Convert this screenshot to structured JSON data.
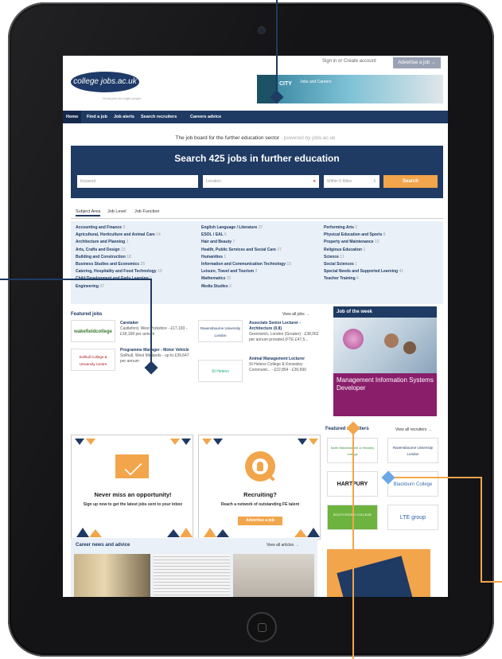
{
  "header": {
    "signin": "Sign in",
    "separator": "or",
    "create_account": "Create account",
    "advertise": "Advertise a job →",
    "logo_text": "college jobs.ac.uk",
    "logo_tagline": "Great jobs for bright people",
    "banner_city": "CITY",
    "banner_text": "Jobs and Careers"
  },
  "nav": {
    "items": [
      "Home",
      "Find a job",
      "Job alerts",
      "Search recruiters",
      "Careers advice"
    ]
  },
  "tagline": {
    "main": "The job board for the further education sector",
    "sub": " - powered by jobs.ac.uk"
  },
  "search": {
    "title": "Search 425 jobs in further education",
    "keyword_placeholder": "Keyword",
    "location_placeholder": "Location",
    "radius": "Within 5 Miles",
    "button": "Search"
  },
  "tabs": [
    "Subject Area",
    "Job Level",
    "Job Function"
  ],
  "subjects": {
    "col1": [
      {
        "name": "Accounting and Finance",
        "count": "3"
      },
      {
        "name": "Agricultural, Horticulture and Animal Care",
        "count": "14"
      },
      {
        "name": "Architecture and Planning",
        "count": "1"
      },
      {
        "name": "Arts, Crafts and Design",
        "count": "23"
      },
      {
        "name": "Building and Construction",
        "count": "18"
      },
      {
        "name": "Business Studies and Economics",
        "count": "28"
      },
      {
        "name": "Catering, Hospitality and Food Technology",
        "count": "13"
      },
      {
        "name": "Child Development and Early Learning",
        "count": "5"
      },
      {
        "name": "Engineering",
        "count": "37"
      }
    ],
    "col2": [
      {
        "name": "English Language / Literature",
        "count": "27"
      },
      {
        "name": "ESOL / EAL",
        "count": "6"
      },
      {
        "name": "Hair and Beauty",
        "count": "7"
      },
      {
        "name": "Health, Public Services and Social Care",
        "count": "27"
      },
      {
        "name": "Humanities",
        "count": "1"
      },
      {
        "name": "Information and Communication Technology",
        "count": "15"
      },
      {
        "name": "Leisure, Travel and Tourism",
        "count": "3"
      },
      {
        "name": "Mathematics",
        "count": "25"
      },
      {
        "name": "Media Studies",
        "count": "3"
      }
    ],
    "col3": [
      {
        "name": "Performing Arts",
        "count": "2"
      },
      {
        "name": "Physical Education and Sports",
        "count": "6"
      },
      {
        "name": "Property and Maintenance",
        "count": "13"
      },
      {
        "name": "Religious Education",
        "count": "1"
      },
      {
        "name": "Science",
        "count": "11"
      },
      {
        "name": "Social Sciences",
        "count": "1"
      },
      {
        "name": "Special Needs and Supported Learning",
        "count": "41"
      },
      {
        "name": "Teacher Training",
        "count": "4"
      }
    ]
  },
  "featured": {
    "title": "Featured jobs",
    "view_all": "View all jobs →",
    "jobs": [
      {
        "logo": "wakefieldcollege",
        "title": "Caretaker",
        "detail": "Castleford, West Yorkshire - £17,193 - £18,168 per annum"
      },
      {
        "logo": "Solihull College & University Centre",
        "title": "Programme Manager - Motor Vehicle",
        "detail": "Solihull, West Midlands - up to £39,647 per annum"
      },
      {
        "logo": "Ravensbourne University London",
        "title": "Associate Senior Lecturer - Architecture (0.8)",
        "detail": "Greenwich, London (Greater) - £38,062 per annum prorated (FTE £47,5..."
      },
      {
        "logo": "St Helens",
        "title": "Animal Management Lecturer",
        "detail": "St Helens College & Knowsley Communit... - £22,854 - £30,690"
      }
    ]
  },
  "job_of_week": {
    "title": "Job of the week",
    "job": "Management Information Systems Developer"
  },
  "promos": [
    {
      "title": "Never miss an opportunity!",
      "text": "Sign up now to get the latest jobs sent to your inbox"
    },
    {
      "title": "Recruiting?",
      "text": "Reach a network of outstanding FE talent",
      "button": "Advertise a job"
    }
  ],
  "recruiters": {
    "title": "Featured recruiters",
    "view_all": "View all recruiters →",
    "logos": [
      "North Warwickshire & Hinckley College",
      "Ravensbourne University London",
      "HARTPURY",
      "Blackburn College",
      "SOUTH ESSEX COLLEGE",
      "LTE group"
    ]
  },
  "news": {
    "title": "Career news and advice",
    "view_all": "View all articles →"
  },
  "colors": {
    "navy": "#1f3a63",
    "orange": "#f2a54b",
    "plum": "#8a1e6b",
    "light_blue": "#e9f0f7"
  }
}
